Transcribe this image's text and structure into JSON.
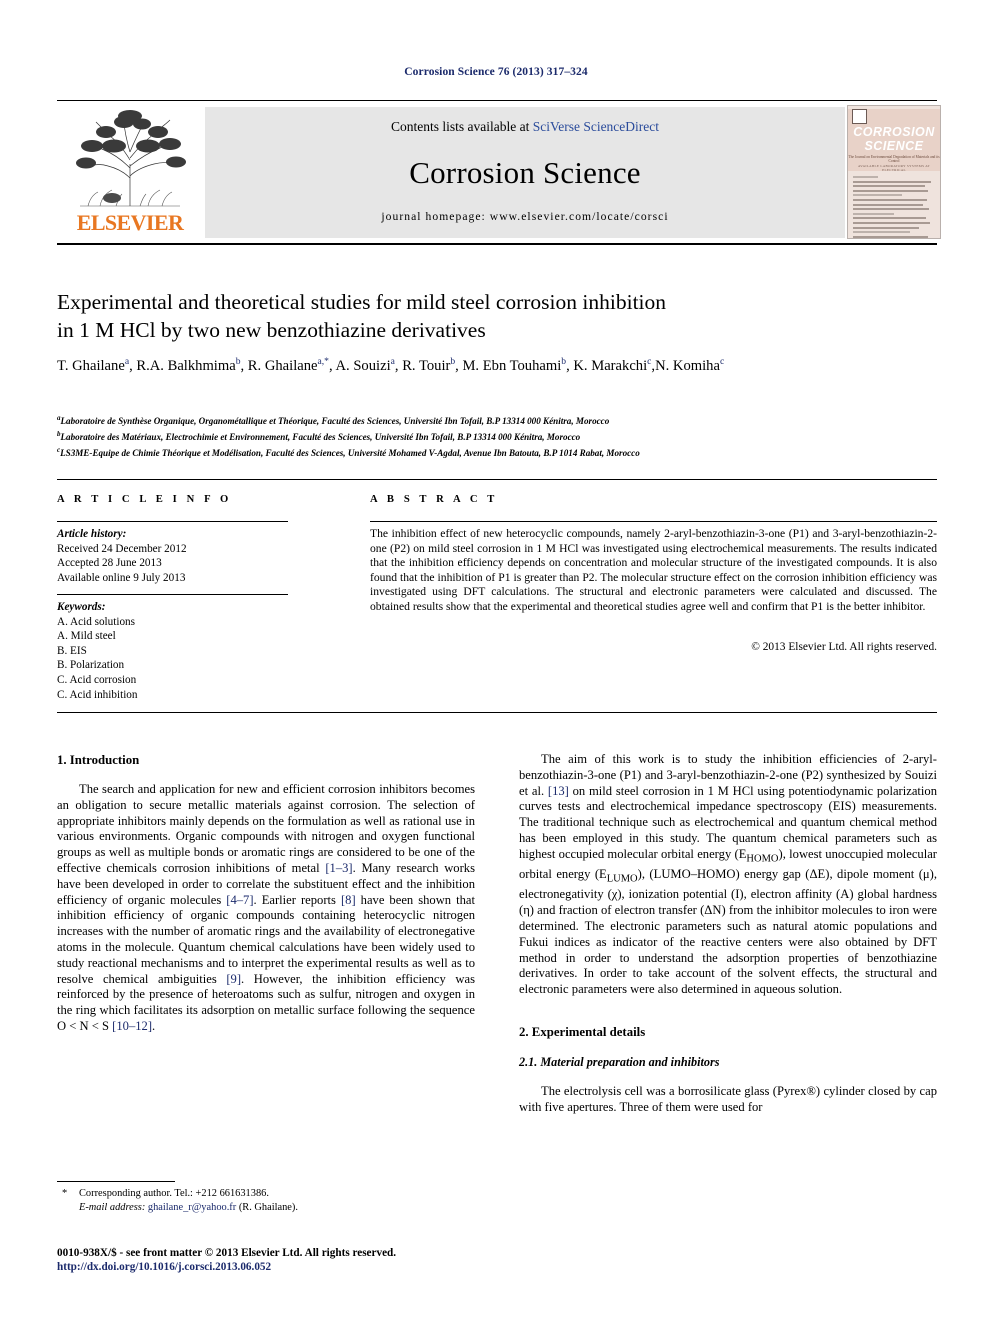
{
  "running_head": "Corrosion Science 76 (2013) 317–324",
  "masthead": {
    "contents_prefix": "Contents lists available at ",
    "contents_link": "SciVerse ScienceDirect",
    "journal_title": "Corrosion Science",
    "homepage": "journal homepage: www.elsevier.com/locate/corsci",
    "publisher_wordmark": "ELSEVIER",
    "cover": {
      "line1": "CORROSION",
      "line2": "SCIENCE",
      "subtitle": "The Journal on Environmental Degradation of Materials and its Control",
      "publisher": "AVAILABLE  LABORATORY  SYSTEMS  AT  ELECTRICAL"
    }
  },
  "article": {
    "title_line1": "Experimental and theoretical studies for mild steel corrosion inhibition",
    "title_line2": "in 1 M HCl by two new benzothiazine derivatives",
    "authors": [
      {
        "name": "T. Ghailane",
        "sup": "a",
        "sep": ", "
      },
      {
        "name": "R.A. Balkhmima",
        "sup": "b",
        "sep": ", "
      },
      {
        "name": "R. Ghailane",
        "sup": "a,*",
        "sep": ", "
      },
      {
        "name": "A. Souizi",
        "sup": "a",
        "sep": ", "
      },
      {
        "name": "R. Touir",
        "sup": "b",
        "sep": ", "
      },
      {
        "name": "M. Ebn Touhami",
        "sup": "b",
        "sep": ", "
      },
      {
        "name": "K. Marakchi",
        "sup": "c",
        "sep": ","
      },
      {
        "name": "N. Komiha",
        "sup": "c",
        "sep": ""
      }
    ],
    "affiliations": [
      {
        "sup": "a",
        "text": "Laboratoire de Synthèse Organique, Organométallique et Théorique, Faculté des Sciences, Université Ibn Tofail, B.P 13314 000 Kénitra, Morocco"
      },
      {
        "sup": "b",
        "text": "Laboratoire des Matériaux, Electrochimie et Environnement, Faculté des Sciences, Université Ibn Tofail, B.P 13314 000 Kénitra, Morocco"
      },
      {
        "sup": "c",
        "text": "LS3ME-Equipe de Chimie Théorique et Modélisation, Faculté des Sciences, Université Mohamed V-Agdal, Avenue Ibn Batouta, B.P 1014 Rabat, Morocco"
      }
    ]
  },
  "article_info": {
    "heading": "A R T I C L E   I N F O",
    "history_label": "Article history:",
    "history": [
      "Received 24 December 2012",
      "Accepted 28 June 2013",
      "Available online 9 July 2013"
    ],
    "keywords_label": "Keywords:",
    "keywords": [
      "A. Acid solutions",
      "A. Mild steel",
      "B. EIS",
      "B. Polarization",
      "C. Acid corrosion",
      "C. Acid inhibition"
    ]
  },
  "abstract": {
    "heading": "A B S T R A C T",
    "text": "The inhibition effect of new heterocyclic compounds, namely 2-aryl-benzothiazin-3-one (P1) and 3-aryl-benzothiazin-2-one (P2) on mild steel corrosion in 1 M HCl was investigated using electrochemical measurements. The results indicated that the inhibition efficiency depends on concentration and molecular structure of the investigated compounds. It is also found that the inhibition of P1 is greater than P2. The molecular structure effect on the corrosion inhibition efficiency was investigated using DFT calculations. The structural and electronic parameters were calculated and discussed. The obtained results show that the experimental and theoretical studies agree well and confirm that P1 is the better inhibitor.",
    "copyright": "© 2013 Elsevier Ltd. All rights reserved."
  },
  "body": {
    "section1_heading": "1. Introduction",
    "intro_p1_a": "The search and application for new and efficient corrosion inhibitors becomes an obligation to secure metallic materials against corrosion. The selection of appropriate inhibitors mainly depends on the formulation as well as rational use in various environments. Organic compounds with nitrogen and oxygen functional groups as well as multiple bonds or aromatic rings are considered to be one of the effective chemicals corrosion inhibitions of metal ",
    "ref_1_3": "[1–3]",
    "intro_p1_b": ". Many research works have been developed in order to correlate the substituent effect and the inhibition efficiency of organic molecules ",
    "ref_4_7": "[4–7]",
    "intro_p1_c": ". Earlier reports ",
    "ref_8": "[8]",
    "intro_p1_d": " have been shown that inhibition efficiency of organic compounds containing heterocyclic nitrogen increases with the number of aromatic rings and the availability of electronegative atoms in the molecule. Quantum chemical calculations have been widely used to study reactional mechanisms and to interpret the experimental results as well as to resolve chemical ambiguities ",
    "ref_9": "[9]",
    "intro_p1_e": ". However, the inhibition efficiency was reinforced by the presence of heteroatoms such as sulfur, nitrogen and oxygen in the ring which facilitates its adsorption on metallic surface following the sequence O < N < S ",
    "ref_10_12": "[10–12]",
    "intro_p1_f": ".",
    "intro_p2_a": "The aim of this work is to study the inhibition efficiencies of 2-aryl-benzothiazin-3-one (P1) and 3-aryl-benzothiazin-2-one (P2) synthesized by Souizi et al. ",
    "ref_13": "[13]",
    "intro_p2_b": " on mild steel corrosion in 1 M HCl using potentiodynamic polarization curves tests and electrochemical impedance spectroscopy (EIS) measurements. The traditional technique such as electrochemical and quantum chemical method has been employed in this study. The quantum chemical parameters such as highest occupied molecular orbital energy (E",
    "sub_homo": "HOMO",
    "intro_p2_c": "), lowest unoccupied molecular orbital energy (E",
    "sub_lumo": "LUMO",
    "intro_p2_d": "), (LUMO–HOMO) energy gap (ΔE), dipole moment (μ), electronegativity (χ), ionization potential (I), electron affinity (A) global hardness (η) and fraction of electron transfer (ΔN) from the inhibitor molecules to iron were determined. The electronic parameters such as natural atomic populations and Fukui indices as indicator of the reactive centers were also obtained by DFT method in order to understand the adsorption properties of benzothiazine derivatives. In order to take account of the solvent effects, the structural and electronic parameters were also determined in aqueous solution.",
    "section2_heading": "2. Experimental details",
    "section21_heading": "2.1. Material preparation and inhibitors",
    "exp_p1": "The electrolysis cell was a borrosilicate glass (Pyrex®) cylinder closed by cap with five apertures. Three of them were used for"
  },
  "footer": {
    "star": "*",
    "corresponding": "Corresponding author. Tel.: +212 661631386.",
    "email_label": "E-mail address:",
    "email": "ghailane_r@yahoo.fr",
    "email_suffix": " (R. Ghailane).",
    "issn_line": "0010-938X/$ - see front matter © 2013 Elsevier Ltd. All rights reserved.",
    "doi": "http://dx.doi.org/10.1016/j.corsci.2013.06.052"
  }
}
